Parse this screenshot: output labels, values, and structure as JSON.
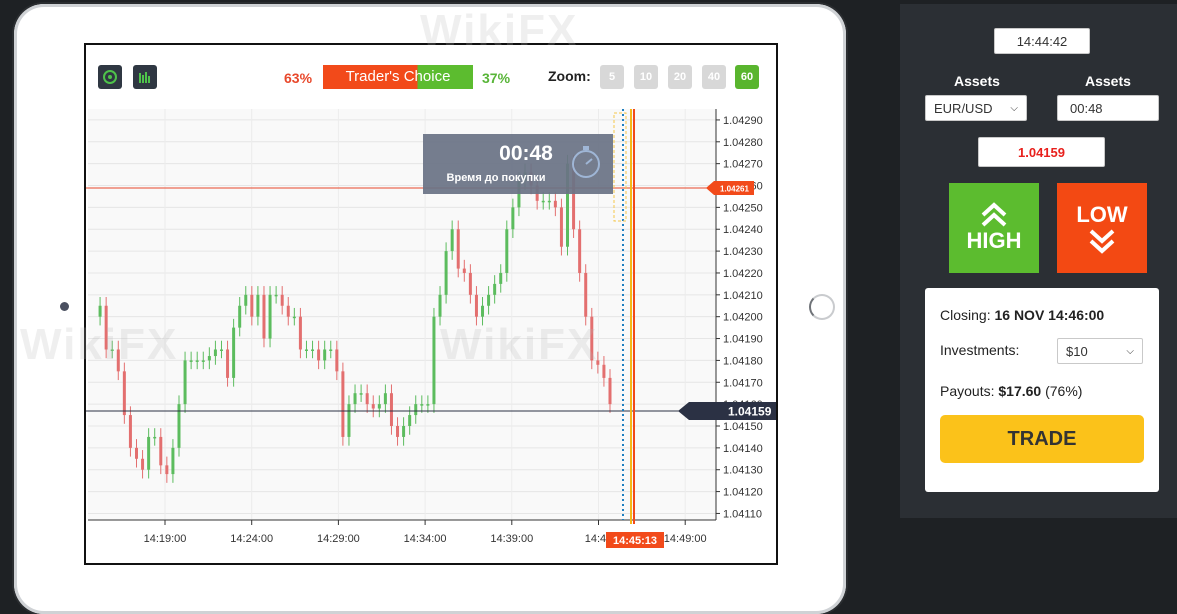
{
  "chart_toolbar": {
    "left_pct": "63%",
    "right_pct": "37%",
    "traders_choice_label": "Trader's Choice",
    "zoom_label": "Zoom:",
    "zoom_options": [
      "5",
      "10",
      "20",
      "40",
      "60"
    ],
    "zoom_selected": "60",
    "icons": [
      "target-icon",
      "bar-chart-icon"
    ]
  },
  "timer_overlay": {
    "time": "00:48",
    "caption": "Время до покупки",
    "icon": "stopwatch-icon"
  },
  "price_marks": {
    "target_label": "1.04261",
    "current_label": "1.04159",
    "time_label": "14:45:13",
    "partial_time_label": "14:44"
  },
  "chart_data": {
    "type": "candlestick",
    "xlabel": "",
    "ylabel": "",
    "y_ticks": [
      "1.04290",
      "1.04280",
      "1.04270",
      "1.04260",
      "1.04250",
      "1.04240",
      "1.04230",
      "1.04220",
      "1.04210",
      "1.04200",
      "1.04190",
      "1.04180",
      "1.04170",
      "1.04160",
      "1.04150",
      "1.04140",
      "1.04130",
      "1.04120",
      "1.04110"
    ],
    "x_ticks": [
      "14:19:00",
      "14:24:00",
      "14:29:00",
      "14:34:00",
      "14:39:00",
      "14:44:00",
      "14:49:00"
    ],
    "ylim": [
      1.04107,
      1.04295
    ],
    "grid": true,
    "target_price": 1.04261,
    "current_price": 1.04159,
    "colors": {
      "up": "#5cbc5e",
      "down": "#e36f6f"
    },
    "closes": [
      1.042,
      1.04205,
      1.04185,
      1.04185,
      1.04175,
      1.04155,
      1.0414,
      1.04135,
      1.0413,
      1.04145,
      1.04145,
      1.04132,
      1.04128,
      1.0414,
      1.0416,
      1.0418,
      1.0418,
      1.0418,
      1.0418,
      1.04182,
      1.04185,
      1.04185,
      1.04172,
      1.04195,
      1.04205,
      1.0421,
      1.042,
      1.0421,
      1.0419,
      1.0421,
      1.0421,
      1.04205,
      1.042,
      1.042,
      1.04185,
      1.04185,
      1.04185,
      1.0418,
      1.04185,
      1.04185,
      1.04175,
      1.04145,
      1.0416,
      1.04165,
      1.04165,
      1.0416,
      1.04158,
      1.0416,
      1.04165,
      1.0415,
      1.04145,
      1.0415,
      1.04155,
      1.0416,
      1.0416,
      1.0416,
      1.042,
      1.0421,
      1.0423,
      1.0424,
      1.04222,
      1.0422,
      1.0421,
      1.042,
      1.04205,
      1.0421,
      1.04215,
      1.0422,
      1.0424,
      1.0425,
      1.04262,
      1.04266,
      1.0426,
      1.04253,
      1.04253,
      1.04253,
      1.0425,
      1.04232,
      1.0427,
      1.0424,
      1.0422,
      1.042,
      1.0418,
      1.04178,
      1.04172,
      1.0416
    ],
    "series_x_range_minutes": [
      "14:16:45",
      "14:44:40"
    ]
  },
  "right_panel": {
    "clock": "14:44:42",
    "assets_label_1": "Assets",
    "assets_label_2": "Assets",
    "asset_selected": "EUR/USD",
    "expiry_value": "00:48",
    "price": "1.04159",
    "high_label": "HIGH",
    "low_label": "LOW",
    "closing_label": "Closing:",
    "closing_value": "16 NOV 14:46:00",
    "investments_label": "Investments:",
    "investment_selected": "$10",
    "payouts_label": "Payouts:",
    "payouts_value": "$17.60",
    "payouts_pct": "(76%)",
    "trade_label": "TRADE",
    "price_color": "#e8201c"
  },
  "watermarks": [
    "WikiFX",
    "WikiFX",
    "WikiFX"
  ]
}
